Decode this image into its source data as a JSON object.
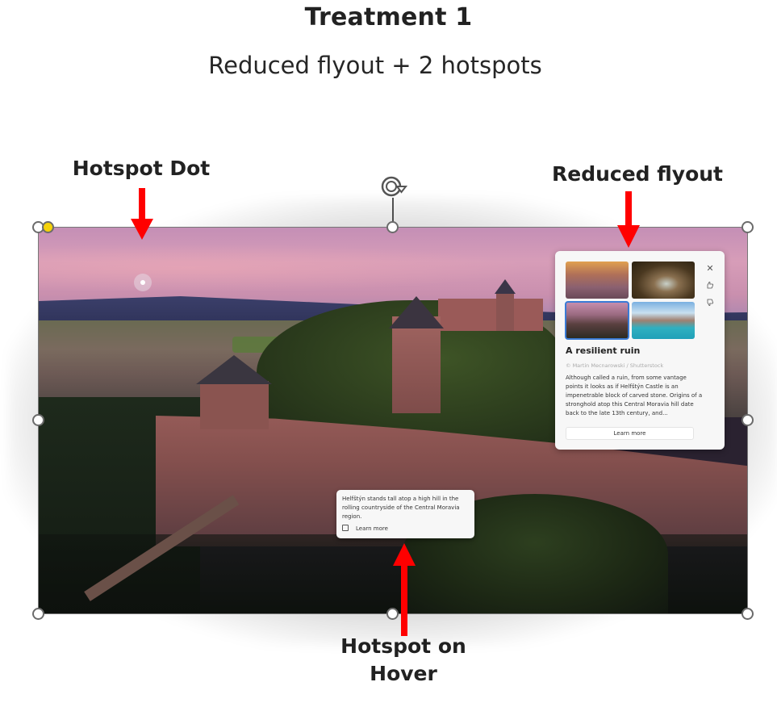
{
  "slide": {
    "title": "Treatment 1",
    "subtitle": "Reduced flyout + 2 hotspots"
  },
  "callouts": {
    "hotspot_dot": "Hotspot Dot",
    "reduced_flyout": "Reduced flyout",
    "hotspot_on_hover": "Hotspot on Hover"
  },
  "colors": {
    "arrow": "#ff0000",
    "selection_handle_border": "#6b6b6b",
    "adjustment_handle": "#f5d20a",
    "selected_thumbnail": "#3a7bd5"
  },
  "flyout": {
    "thumbnails": [
      {
        "name": "sunset-rocky-coast",
        "selected": false
      },
      {
        "name": "cave-arch",
        "selected": false
      },
      {
        "name": "castle-ruin",
        "selected": true
      },
      {
        "name": "turquoise-bay",
        "selected": false
      }
    ],
    "icons": [
      "close-icon",
      "thumbs-up-icon",
      "thumbs-down-icon"
    ],
    "icon_glyphs": {
      "close": "✕",
      "like": "♁",
      "dislike": "♡"
    },
    "title": "A resilient ruin",
    "credit": "© Martin Mecnarowski / Shutterstock",
    "body": "Although called a ruin, from some vantage points it looks as if Helfštýn Castle is an impenetrable block of carved stone. Origins of a stronghold atop this Central Moravia hill date back to the late 13th century, and...",
    "learn_more": "Learn more"
  },
  "hover_card": {
    "text": "Helfštýn stands tall atop a high hill in the rolling countryside of the Central Moravia region.",
    "learn_more": "Learn more",
    "icon": "open-external-icon"
  }
}
